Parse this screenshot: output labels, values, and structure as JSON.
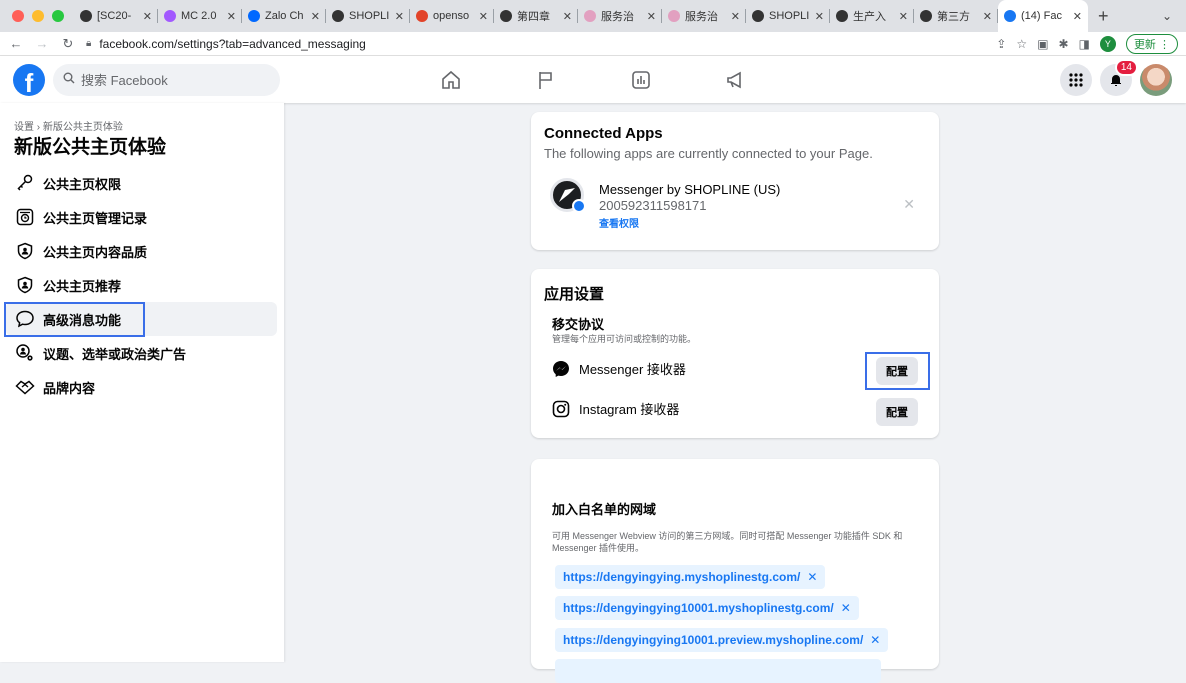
{
  "browser": {
    "tabs": [
      {
        "label": "[SC20-",
        "color": "#333333"
      },
      {
        "label": "MC 2.0",
        "color": "#a259ff"
      },
      {
        "label": "Zalo Ch",
        "color": "#0068ff"
      },
      {
        "label": "SHOPLI",
        "color": "#333333"
      },
      {
        "label": "openso",
        "color": "#e24329"
      },
      {
        "label": "第四章",
        "color": "#333333"
      },
      {
        "label": "服务治",
        "color": "#e2a0c0"
      },
      {
        "label": "服务治",
        "color": "#e2a0c0"
      },
      {
        "label": "SHOPLI",
        "color": "#333333"
      },
      {
        "label": "生产入",
        "color": "#333333"
      },
      {
        "label": "第三方",
        "color": "#333333"
      }
    ],
    "active_tab": {
      "label": "(14) Fac",
      "color": "#1877f2"
    },
    "new_tab": "+",
    "tab_menu": "⌄",
    "url": "facebook.com/settings?tab=advanced_messaging",
    "profile_initial": "Y",
    "update_label": "更新"
  },
  "fb": {
    "logo": "f",
    "search_placeholder": "搜索 Facebook",
    "notification_count": "14"
  },
  "sidebar": {
    "breadcrumb": "设置 › 新版公共主页体验",
    "title": "新版公共主页体验",
    "items": [
      {
        "label": "公共主页权限",
        "icon": "key-icon"
      },
      {
        "label": "公共主页管理记录",
        "icon": "history-icon"
      },
      {
        "label": "公共主页内容品质",
        "icon": "shield-icon"
      },
      {
        "label": "公共主页推荐",
        "icon": "shield-person-icon"
      },
      {
        "label": "高级消息功能",
        "icon": "chat-bubble-icon"
      },
      {
        "label": "议题、选举或政治类广告",
        "icon": "person-gear-icon"
      },
      {
        "label": "品牌内容",
        "icon": "handshake-icon"
      }
    ]
  },
  "connected_apps": {
    "title": "Connected Apps",
    "subtitle": "The following apps are currently connected to your Page.",
    "app_name": "Messenger by SHOPLINE (US)",
    "app_id": "200592311598171",
    "view_permissions": "查看权限"
  },
  "app_settings": {
    "title": "应用设置",
    "handover_title": "移交协议",
    "handover_desc": "管理每个应用可访问或控制的功能。",
    "messenger_receiver": "Messenger 接收器",
    "instagram_receiver": "Instagram 接收器",
    "configure_label": "配置"
  },
  "whitelist": {
    "title": "加入白名单的网域",
    "description": "可用 Messenger Webview 访问的第三方网域。同时可搭配 Messenger 功能插件 SDK 和 Messenger 插件使用。",
    "domains": [
      "https://dengyingying.myshoplinestg.com/",
      "https://dengyingying10001.myshoplinestg.com/",
      "https://dengyingying10001.preview.myshopline.com/"
    ]
  }
}
